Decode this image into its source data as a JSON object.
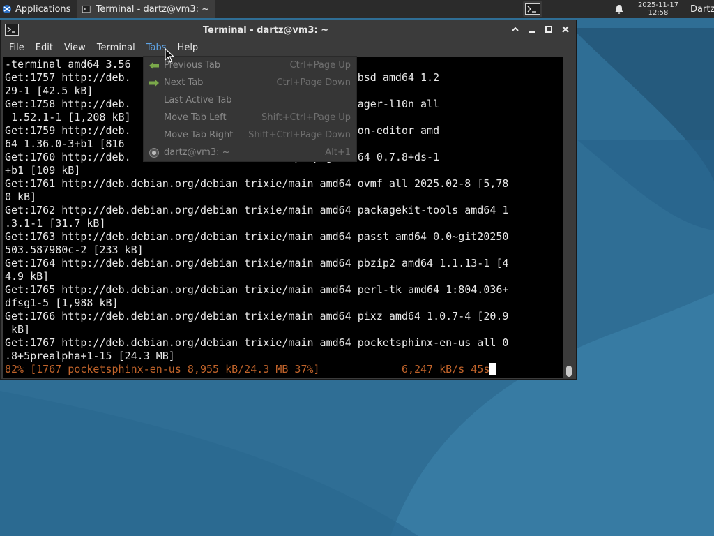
{
  "panel": {
    "applications_label": "Applications",
    "task_title": "Terminal - dartz@vm3: ~",
    "clock_date": "2025-11-17",
    "clock_time": "12:58",
    "user": "Dartz"
  },
  "window": {
    "title": "Terminal - dartz@vm3: ~"
  },
  "menubar": {
    "items": [
      "File",
      "Edit",
      "View",
      "Terminal",
      "Tabs",
      "Help"
    ],
    "active": "Tabs"
  },
  "terminal": {
    "lines": [
      "-terminal amd64 3.56",
      "Get:1757 http://deb.                   amd64 netcat-openbsd amd64 1.2",
      "29-1 [42.5 kB]",
      "Get:1758 http://deb.                   amd64 network-manager-l10n all",
      " 1.52.1-1 [1,208 kB]",
      "Get:1759 http://deb.                   amd64 nm-connection-editor amd",
      "64 1.36.0-3+b1 [816",
      "Get:1760 http://deb.                   amd64 optipng amd64 0.7.8+ds-1",
      "+b1 [109 kB]",
      "Get:1761 http://deb.debian.org/debian trixie/main amd64 ovmf all 2025.02-8 [5,78",
      "0 kB]",
      "Get:1762 http://deb.debian.org/debian trixie/main amd64 packagekit-tools amd64 1",
      ".3.1-1 [31.7 kB]",
      "Get:1763 http://deb.debian.org/debian trixie/main amd64 passt amd64 0.0~git20250",
      "503.587980c-2 [233 kB]",
      "Get:1764 http://deb.debian.org/debian trixie/main amd64 pbzip2 amd64 1.1.13-1 [4",
      "4.9 kB]",
      "Get:1765 http://deb.debian.org/debian trixie/main amd64 perl-tk amd64 1:804.036+",
      "dfsg1-5 [1,988 kB]",
      "Get:1766 http://deb.debian.org/debian trixie/main amd64 pixz amd64 1.0.7-4 [20.9",
      " kB]",
      "Get:1767 http://deb.debian.org/debian trixie/main amd64 pocketsphinx-en-us all 0",
      ".8+5prealpha+1-15 [24.3 MB]"
    ],
    "progress_line": "82% [1767 pocketsphinx-en-us 8,955 kB/24.3 MB 37%]             6,247 kB/s 45s"
  },
  "tabs_menu": {
    "items": [
      {
        "label": "Previous Tab",
        "accel": "Ctrl+Page Up",
        "icon": "arrow-left-icon"
      },
      {
        "label": "Next Tab",
        "accel": "Ctrl+Page Down",
        "icon": "arrow-right-icon"
      },
      {
        "label": "Last Active Tab",
        "accel": "",
        "icon": ""
      },
      {
        "label": "Move Tab Left",
        "accel": "Shift+Ctrl+Page Up",
        "icon": ""
      },
      {
        "label": "Move Tab Right",
        "accel": "Shift+Ctrl+Page Down",
        "icon": ""
      },
      {
        "label": "dartz@vm3: ~",
        "accel": "Alt+1",
        "icon": "radio-selected-icon"
      }
    ]
  },
  "colors": {
    "desktop": "#2f6e95",
    "panel": "#2b2b2b",
    "progress_text": "#c0632a",
    "menu_active": "#5fa4e6",
    "arrow_icon": "#7aa84a"
  }
}
